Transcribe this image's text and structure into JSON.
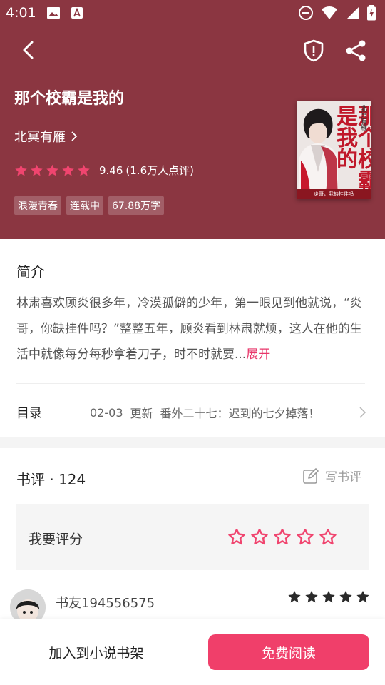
{
  "status_bar": {
    "time": "4:01"
  },
  "book": {
    "title": "那个校霸是我的",
    "author": "北冥有雁",
    "rating": "9.46",
    "rating_count": "(1.6万人点评)",
    "rating_stars": 5,
    "tags": [
      "浪漫青春",
      "连载中",
      "67.88万字"
    ],
    "cover": {
      "title": "那个校霸是我的",
      "author": "北冥有雁",
      "badge": "校园",
      "bottom_text": "炎哥，我缺挂件吗"
    }
  },
  "intro": {
    "heading": "简介",
    "text": "林肃喜欢顾炎很多年，冷漠孤僻的少年，第一眼见到他就说，“炎哥，你缺挂件吗？”整整五年，顾炎看到林肃就烦，这人在他的生活中就像每分每秒拿着刀子，时不时就要...",
    "more": "展开"
  },
  "toc": {
    "label": "目录",
    "date": "02-03",
    "update": "更新",
    "chapter": "番外二十七：迟到的七夕掉落！"
  },
  "reviews": {
    "heading": "书评 · 124",
    "write_label": "写书评",
    "rate_label": "我要评分",
    "first_comment": {
      "user": "书友194556575",
      "stars": 5
    }
  },
  "actions": {
    "add_to_shelf": "加入到小说书架",
    "free_read": "免费阅读"
  },
  "colors": {
    "hero_bg": "#8b3641",
    "accent": "#f03f6a",
    "star_pink": "#f0456f"
  }
}
